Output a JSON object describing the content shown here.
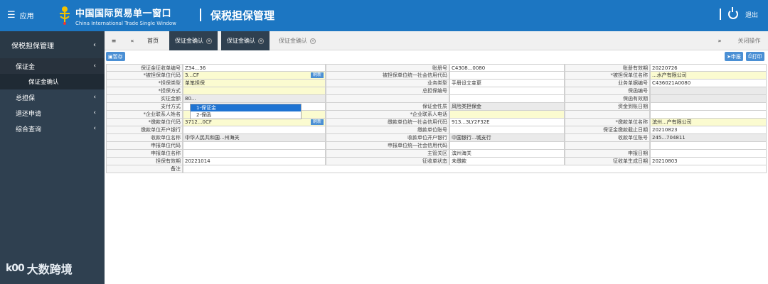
{
  "topbar": {
    "menu_label": "应用",
    "brand_cn": "中国国际贸易单一窗口",
    "brand_en": "China International Trade Single Window",
    "system_title": "保税担保管理",
    "logout_label": "退出"
  },
  "sidebar": {
    "header": "保税担保管理",
    "items": [
      {
        "label": "保证金"
      },
      {
        "label": "保证金确认"
      },
      {
        "label": "总担保"
      },
      {
        "label": "退还申请"
      },
      {
        "label": "综合查询"
      }
    ]
  },
  "tabs": {
    "home": "首页",
    "tab1": "保证金确认",
    "tab2": "保证金确认",
    "tab3": "保证金确认",
    "close_ops": "关闭操作"
  },
  "toolbar": {
    "save": "暂存",
    "declare": "申报",
    "print": "打印"
  },
  "form": {
    "rows": [
      [
        [
          "保证金征收单编号",
          "Z34...36",
          ""
        ],
        [
          "账册号",
          "C4308...0080",
          ""
        ],
        [
          "账册有效期",
          "20220726",
          ""
        ]
      ],
      [
        [
          "*被担保单位代码",
          "3...CF",
          "y"
        ],
        [
          "被担保单位统一社会信用代码",
          "",
          ""
        ],
        [
          "*被担保单位名称",
          "...水产有限公司",
          "y"
        ]
      ],
      [
        [
          "*担保类型",
          "单笔担保",
          "y"
        ],
        [
          "业务类型",
          "手册设立变更",
          ""
        ],
        [
          "业务单据编号",
          "C436021A0080",
          ""
        ]
      ],
      [
        [
          "*担保方式",
          "",
          "y"
        ],
        [
          "总担保编号",
          "",
          ""
        ],
        [
          "保函编号",
          "",
          "g"
        ]
      ],
      [
        [
          "实征金额",
          "80...",
          "g"
        ],
        [
          "",
          "",
          ""
        ],
        [
          "保函有效期",
          "",
          "g"
        ]
      ],
      [
        [
          "支付方式",
          "",
          ""
        ],
        [
          "保证金性质",
          "风险类担保金",
          "g"
        ],
        [
          "资金到账日期",
          "",
          ""
        ]
      ],
      [
        [
          "*企业联系人姓名",
          "",
          "y"
        ],
        [
          "*企业联系人电话",
          "",
          "y"
        ],
        [
          "",
          "",
          ""
        ]
      ],
      [
        [
          "*缴款单位代码",
          "3712...0CF",
          "y"
        ],
        [
          "缴款单位统一社会信用代码",
          "913...3LY2F32E",
          ""
        ],
        [
          "*缴款单位名称",
          "滨州...产有限公司",
          "y"
        ]
      ],
      [
        [
          "缴款单位开户银行",
          "",
          ""
        ],
        [
          "缴款单位账号",
          "",
          ""
        ],
        [
          "保证金缴款截止日期",
          "20210823",
          ""
        ]
      ],
      [
        [
          "收款单位名称",
          "中华人民共和国...州海关",
          "g"
        ],
        [
          "收款单位开户银行",
          "中国银行...城支行",
          "g"
        ],
        [
          "收款单位账号",
          "245...704811",
          "g"
        ]
      ],
      [
        [
          "申报单位代码",
          "",
          ""
        ],
        [
          "申报单位统一社会信用代码",
          "",
          ""
        ],
        [
          "",
          "",
          ""
        ]
      ],
      [
        [
          "申报单位名称",
          "",
          ""
        ],
        [
          "主管关区",
          "滨州海关",
          ""
        ],
        [
          "申报日期",
          "",
          ""
        ]
      ],
      [
        [
          "担保有效期",
          "20221014",
          ""
        ],
        [
          "征收单状态",
          "未缴款",
          ""
        ],
        [
          "征收单生成日期",
          "20210803",
          ""
        ]
      ],
      [
        [
          "备注",
          "",
          ""
        ]
      ]
    ],
    "refresh_label": "刷新"
  },
  "dropdown": {
    "options": [
      "1-保证金",
      "2-保函"
    ]
  },
  "watermark": {
    "logo": "k00",
    "text": "大数跨境"
  }
}
